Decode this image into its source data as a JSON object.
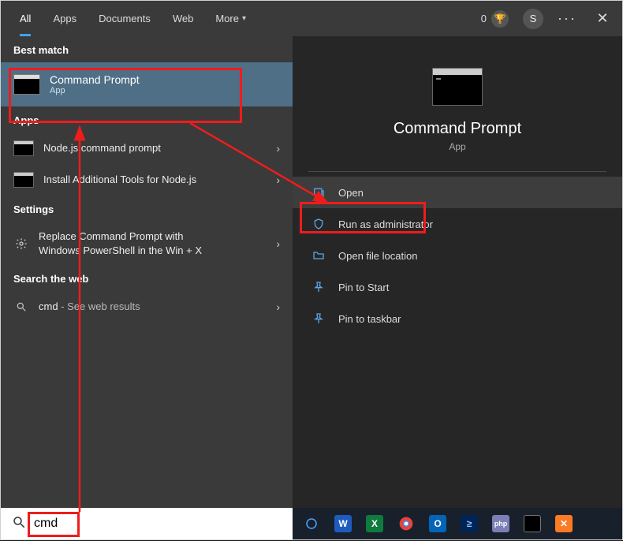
{
  "tabs": {
    "all": "All",
    "apps": "Apps",
    "documents": "Documents",
    "web": "Web",
    "more": "More"
  },
  "topright": {
    "rewards_points": "0",
    "avatar_initial": "S"
  },
  "left": {
    "best_match_label": "Best match",
    "best_match": {
      "title": "Command Prompt",
      "subtitle": "App"
    },
    "apps_label": "Apps",
    "apps": [
      {
        "label": "Node.js command prompt"
      },
      {
        "label": "Install Additional Tools for Node.js"
      }
    ],
    "settings_label": "Settings",
    "settings": [
      {
        "line1": "Replace Command Prompt with",
        "line2": "Windows PowerShell in the Win + X"
      }
    ],
    "web_label": "Search the web",
    "web_prefix": "cmd",
    "web_suffix": " - See web results"
  },
  "right": {
    "title": "Command Prompt",
    "subtitle": "App",
    "actions": {
      "open": "Open",
      "run_admin": "Run as administrator",
      "open_loc": "Open file location",
      "pin_start": "Pin to Start",
      "pin_taskbar": "Pin to taskbar"
    }
  },
  "search": {
    "value": "cmd"
  },
  "taskbar": {
    "word": "W",
    "excel": "X",
    "outlook": "O",
    "php": "php"
  }
}
